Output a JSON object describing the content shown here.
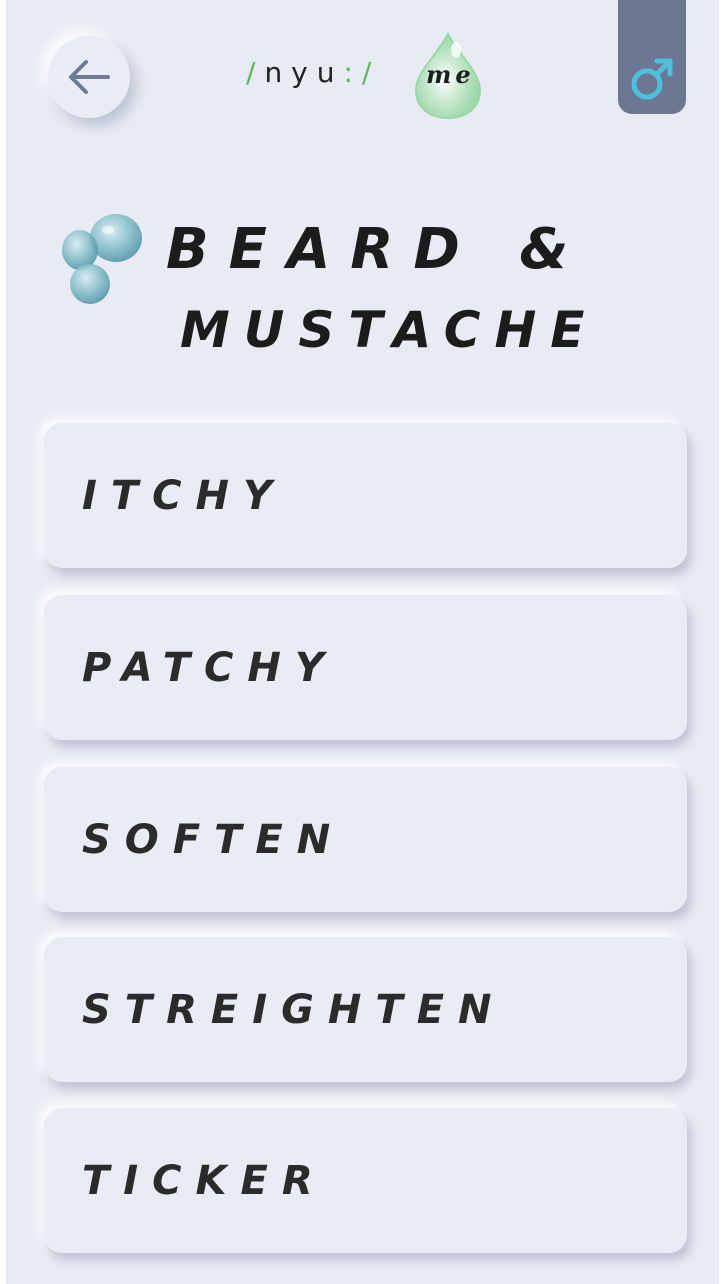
{
  "header": {
    "back_icon": "arrow-left-icon",
    "logo": {
      "prefix_slash": "/",
      "brand": "nyu",
      "colon_slash": ":/",
      "suffix": "me"
    },
    "gender_icon": "male-symbol-icon"
  },
  "title": {
    "line1": "BEARD &",
    "line2": "MUSTACHE"
  },
  "options": [
    {
      "label": "ITCHY"
    },
    {
      "label": "PATCHY"
    },
    {
      "label": "SOFTEN"
    },
    {
      "label": "STREIGHTEN"
    },
    {
      "label": "TICKER"
    }
  ],
  "colors": {
    "background": "#e8ebf3",
    "accent_green": "#5cb85c",
    "gender_button": "#6b7793",
    "gender_icon": "#4fc0dc",
    "arrow": "#6d7b9b"
  }
}
